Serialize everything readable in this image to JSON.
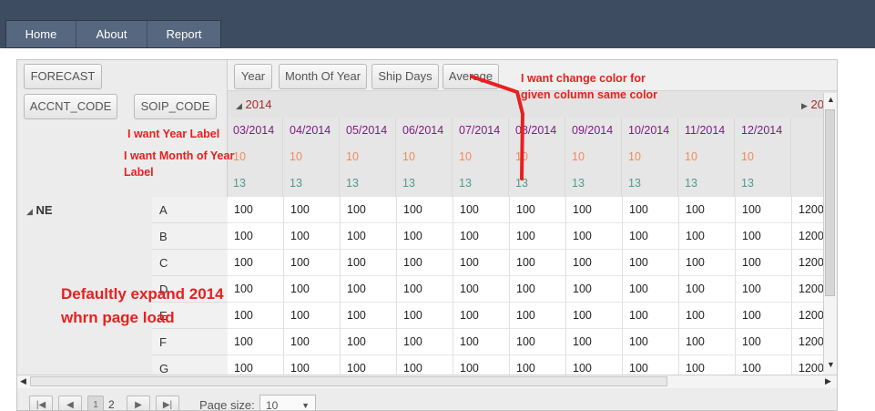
{
  "nav": {
    "items": [
      "Home",
      "About",
      "Report"
    ]
  },
  "pivot": {
    "filter_chip": "FORECAST",
    "row_chips": [
      "ACCNT_CODE",
      "SOIP_CODE"
    ],
    "column_chips": [
      "Year",
      "Month Of Year",
      "Ship Days",
      "Average"
    ],
    "year": "2014",
    "next_year_partial": "20",
    "months": [
      "03/2014",
      "04/2014",
      "05/2014",
      "06/2014",
      "07/2014",
      "08/2014",
      "09/2014",
      "10/2014",
      "11/2014",
      "12/2014"
    ],
    "ship_days_value": "10",
    "average_value": "13",
    "region": "NE",
    "rows": [
      "A",
      "B",
      "C",
      "D",
      "E",
      "F",
      "G"
    ],
    "cell_value": "100",
    "total_value_partial": "1200",
    "page_size_label": "Page size:",
    "page_size_value": "10",
    "pages": [
      "1",
      "2"
    ]
  },
  "annotations": {
    "year_label": "I want Year Label",
    "month_label_1": "I want Month of Year",
    "month_label_2": "Label",
    "color_1": "I want change color for",
    "color_2": "given column  same color",
    "expand_1": "Defaultly expand 2014",
    "expand_2": "whrn page load"
  },
  "colors": {
    "month_text": "#7d1c80",
    "ship_days_text": "#f08a5e",
    "average_text": "#4f9a8c",
    "annotation": "#e8201f",
    "year_text": "#a52a2a"
  }
}
